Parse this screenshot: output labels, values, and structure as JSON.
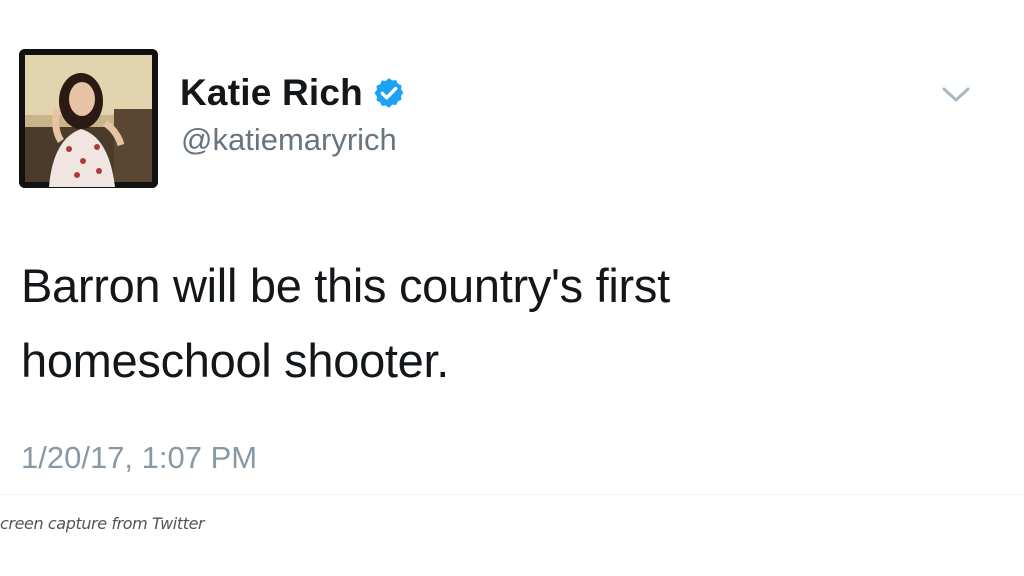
{
  "tweet": {
    "display_name": "Katie Rich",
    "handle": "@katiemaryrich",
    "text_line1": "Barron will be this country's first",
    "text_line2": "homeschool shooter.",
    "timestamp": "1/20/17, 1:07 PM",
    "verified": true,
    "icons": {
      "avatar": "profile-photo",
      "verified": "verified-badge-icon",
      "menu": "chevron-down-icon"
    }
  },
  "caption": "creen capture from Twitter",
  "colors": {
    "name": "#14171a",
    "handle": "#66757f",
    "timestamp": "#8899a6",
    "verified": "#1da1f2",
    "chevron": "#aab8c2"
  }
}
